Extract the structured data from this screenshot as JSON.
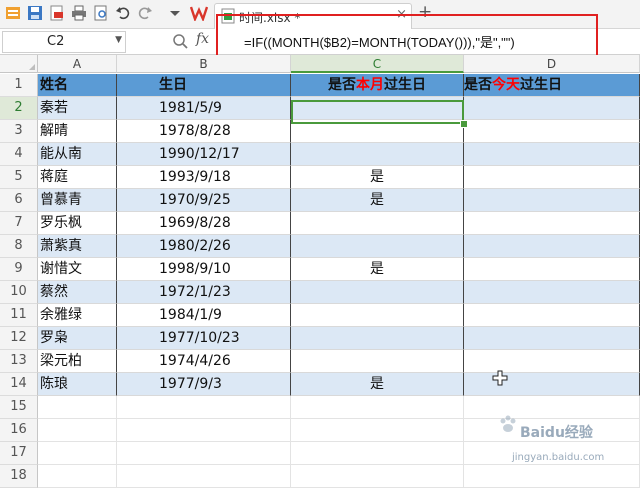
{
  "window": {
    "doc_name": "时间.xlsx *",
    "close_glyph": "×",
    "new_tab_glyph": "+"
  },
  "formula_bar": {
    "name_box": "C2",
    "fx_label": "fx",
    "formula": "=IF((MONTH($B2)=MONTH(TODAY())),\"是\",\"\")"
  },
  "sheet": {
    "columns": [
      "A",
      "B",
      "C",
      "D"
    ],
    "active_column": "C",
    "active_row": 2,
    "header": {
      "name": "姓名",
      "birthday": "生日",
      "c_prefix": "是否",
      "c_red": "本月",
      "c_suffix": "过生日",
      "d_prefix": "是否",
      "d_red": "今天",
      "d_suffix": "过生日"
    },
    "rows": [
      {
        "n": "1"
      },
      {
        "n": "2",
        "name": "秦若",
        "birthday": "1981/5/9",
        "c": ""
      },
      {
        "n": "3",
        "name": "解晴",
        "birthday": "1978/8/28",
        "c": ""
      },
      {
        "n": "4",
        "name": "能从南",
        "birthday": "1990/12/17",
        "c": ""
      },
      {
        "n": "5",
        "name": "蒋庭",
        "birthday": "1993/9/18",
        "c": "是"
      },
      {
        "n": "6",
        "name": "曾慕青",
        "birthday": "1970/9/25",
        "c": "是"
      },
      {
        "n": "7",
        "name": "罗乐枫",
        "birthday": "1969/8/28",
        "c": ""
      },
      {
        "n": "8",
        "name": "萧紫真",
        "birthday": "1980/2/26",
        "c": ""
      },
      {
        "n": "9",
        "name": "谢惜文",
        "birthday": "1998/9/10",
        "c": "是"
      },
      {
        "n": "10",
        "name": "蔡然",
        "birthday": "1972/1/23",
        "c": ""
      },
      {
        "n": "11",
        "name": "余雅绿",
        "birthday": "1984/1/9",
        "c": ""
      },
      {
        "n": "12",
        "name": "罗枭",
        "birthday": "1977/10/23",
        "c": ""
      },
      {
        "n": "13",
        "name": "梁元柏",
        "birthday": "1974/4/26",
        "c": ""
      },
      {
        "n": "14",
        "name": "陈琅",
        "birthday": "1977/9/3",
        "c": "是"
      },
      {
        "n": "15"
      },
      {
        "n": "16"
      },
      {
        "n": "17"
      },
      {
        "n": "18"
      }
    ]
  },
  "watermark": {
    "text": "Baidu经验",
    "url": "jingyan.baidu.com"
  },
  "colors": {
    "header_fill": "#5b9bd5",
    "band_fill": "#dce8f5",
    "highlight_red": "#e02020",
    "selection_green": "#4a9a3c"
  }
}
